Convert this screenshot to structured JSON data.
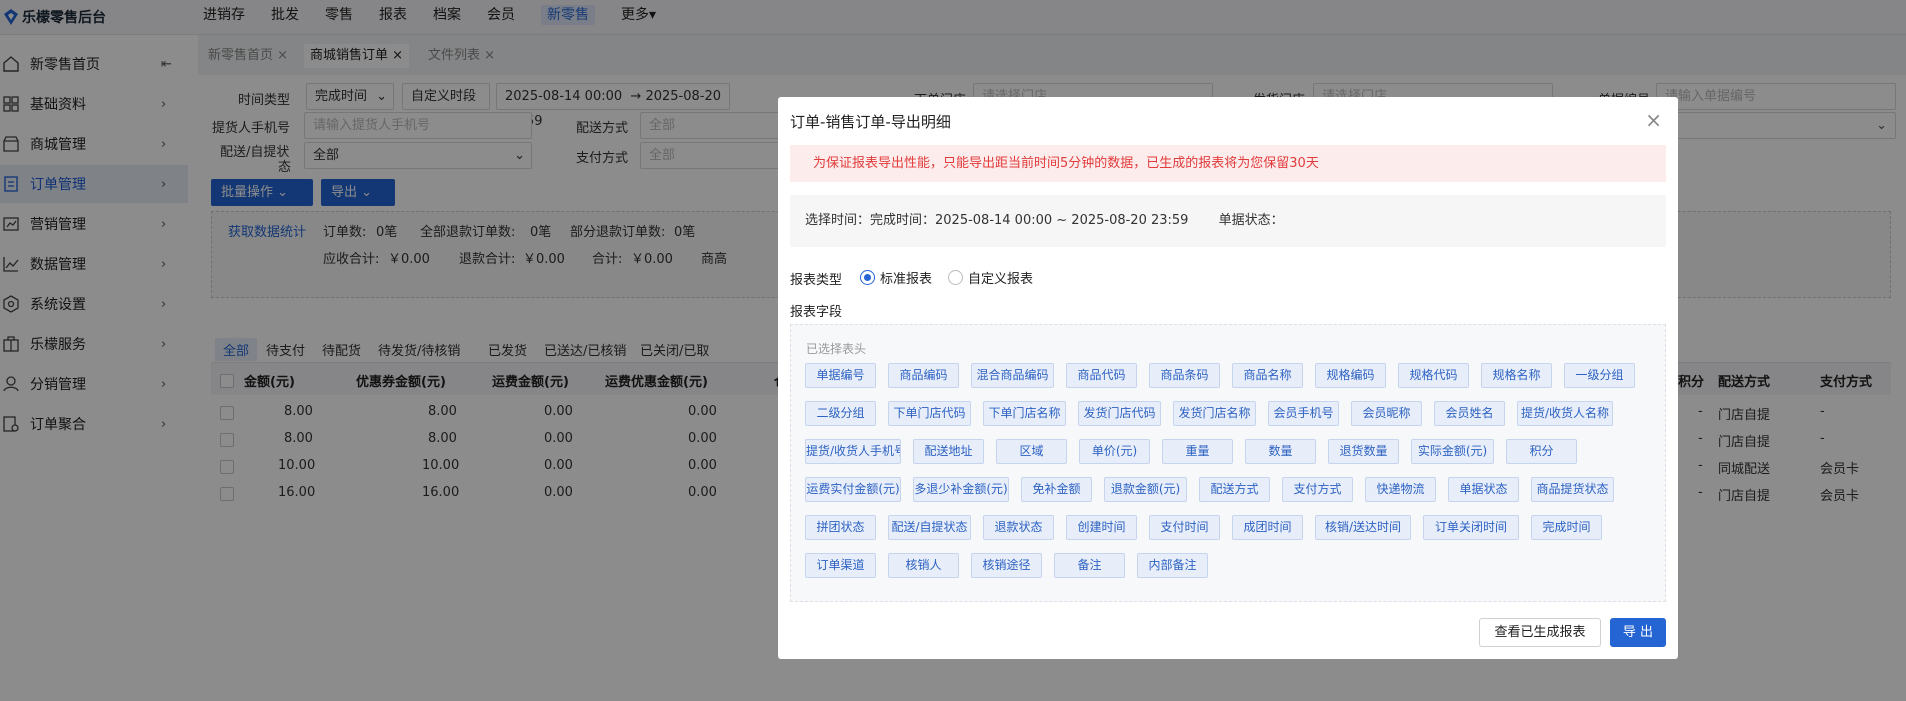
{
  "app": {
    "title": "乐檬零售后台"
  },
  "topnav": [
    {
      "label": "进销存"
    },
    {
      "label": "批发"
    },
    {
      "label": "零售"
    },
    {
      "label": "报表"
    },
    {
      "label": "档案"
    },
    {
      "label": "会员"
    },
    {
      "label": "新零售",
      "active": true
    },
    {
      "label": "更多▾"
    }
  ],
  "sidebar": {
    "home": "新零售首页",
    "items": [
      "基础资料",
      "商城管理",
      "订单管理",
      "营销管理",
      "数据管理",
      "系统设置",
      "乐檬服务",
      "分销管理",
      "订单聚合"
    ],
    "active": "订单管理",
    "collapse_icon": "collapse-left-icon"
  },
  "tabs": [
    {
      "label": "新零售首页 ×"
    },
    {
      "label": "商城销售订单 ×",
      "active": true
    },
    {
      "label": "文件列表 ×"
    }
  ],
  "filters": {
    "time_type_label": "时间类型",
    "time_type_value": "完成时间",
    "period_value": "自定义时段",
    "start": "2025-08-14 00:00",
    "end": "2025-08-20 23:59",
    "order_store_label": "下单门店",
    "order_store_placeholder": "请选择门店",
    "ship_store_label": "发货门店",
    "ship_store_placeholder": "请选择门店",
    "doc_no_label": "单据编号",
    "doc_no_placeholder": "请输入单据编号",
    "phone_label": "提货人手机号",
    "phone_placeholder": "请输入提货人手机号",
    "delivery_label": "配送方式",
    "delivery_value": "全部",
    "pick_label_1": "配送/自提状",
    "pick_label_2": "态",
    "pick_value": "全部",
    "pay_label": "支付方式",
    "pay_value": "全部",
    "right_select_value": "部"
  },
  "actions": {
    "batch": "批量操作",
    "export": "导出"
  },
  "stats": {
    "fetch": "获取数据统计",
    "order_count_label": "订单数:",
    "order_count": "0笔",
    "full_refund_label": "全部退款订单数:",
    "full_refund": "0笔",
    "part_refund_label": "部分退款订单数:",
    "part_refund": "0笔",
    "receivable_label": "应收合计:",
    "receivable": "￥0.00",
    "refund_label": "退款合计:",
    "refund": "￥0.00",
    "total_label": "合计:",
    "total": "￥0.00",
    "goods_label": "商高"
  },
  "status_tabs": [
    "全部",
    "待支付",
    "待配货",
    "待发货/待核销",
    "已发货",
    "已送达/已核销",
    "已关闭/已取"
  ],
  "table": {
    "headers": [
      "金额(元)",
      "优惠券金额(元)",
      "运费金额(元)",
      "运费优惠金额(元)",
      "仓",
      "积分",
      "配送方式",
      "支付方式"
    ],
    "rows": [
      {
        "c1": "8.00",
        "c2": "8.00",
        "c3": "0.00",
        "c4": "0.00",
        "c5": "-",
        "c6": "门店自提",
        "c7": "-"
      },
      {
        "c1": "8.00",
        "c2": "8.00",
        "c3": "0.00",
        "c4": "0.00",
        "c5": "-",
        "c6": "门店自提",
        "c7": "-"
      },
      {
        "c1": "10.00",
        "c2": "10.00",
        "c3": "0.00",
        "c4": "0.00",
        "c5": "-",
        "c6": "同城配送",
        "c7": "会员卡"
      },
      {
        "c1": "16.00",
        "c2": "16.00",
        "c3": "0.00",
        "c4": "0.00",
        "c5": "-",
        "c6": "门店自提",
        "c7": "会员卡"
      }
    ]
  },
  "modal": {
    "title": "订单-销售订单-导出明细",
    "alert": "为保证报表导出性能，只能导出距当前时间5分钟的数据，已生成的报表将为您保留30天",
    "info_time": "选择时间：完成时间：2025-08-14 00:00 ~ 2025-08-20 23:59",
    "info_status": "单据状态：",
    "report_type_label": "报表类型",
    "radio_standard": "标准报表",
    "radio_custom": "自定义报表",
    "fields_label": "报表字段",
    "fields_hint": "已选择表头",
    "fields": [
      "单据编号",
      "商品编码",
      "混合商品编码",
      "商品代码",
      "商品条码",
      "商品名称",
      "规格编码",
      "规格代码",
      "规格名称",
      "一级分组",
      "二级分组",
      "下单门店代码",
      "下单门店名称",
      "发货门店代码",
      "发货门店名称",
      "会员手机号",
      "会员昵称",
      "会员姓名",
      "提货/收货人名称",
      "提货/收货人手机号",
      "配送地址",
      "区域",
      "单价(元)",
      "重量",
      "数量",
      "退货数量",
      "实际金额(元)",
      "积分",
      "运费实付金额(元)",
      "多退少补金额(元)",
      "免补金额",
      "退款金额(元)",
      "配送方式",
      "支付方式",
      "快递物流",
      "单据状态",
      "商品提货状态",
      "拼团状态",
      "配送/自提状态",
      "退款状态",
      "创建时间",
      "支付时间",
      "成团时间",
      "核销/送达时间",
      "订单关闭时间",
      "完成时间",
      "订单渠道",
      "核销人",
      "核销途径",
      "备注",
      "内部备注"
    ],
    "btn_view": "查看已生成报表",
    "btn_export": "导 出"
  }
}
